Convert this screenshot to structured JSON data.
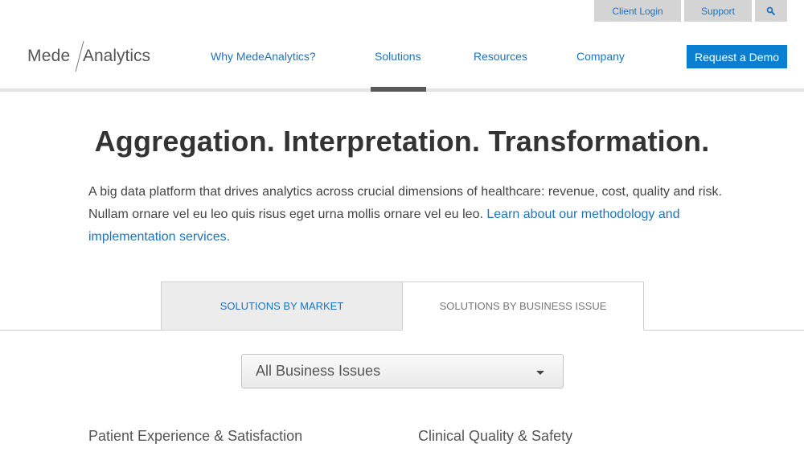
{
  "utility": {
    "client_login": "Client Login",
    "support": "Support",
    "search_icon": "search-icon"
  },
  "logo": {
    "part1": "Mede",
    "part2": "Analytics"
  },
  "nav": {
    "items": [
      {
        "label": "Why MedeAnalytics?"
      },
      {
        "label": "Solutions",
        "active": true
      },
      {
        "label": "Resources"
      },
      {
        "label": "Company"
      }
    ],
    "cta": "Request a Demo"
  },
  "hero": {
    "title": "Aggregation. Interpretation. Transformation.",
    "intro_text": "A big data platform that drives analytics across crucial dimensions of healthcare: revenue, cost, quality and risk. Nullam ornare vel eu leo quis risus eget urna mollis ornare vel eu leo.",
    "intro_link": "Learn about our methodology and implementation services."
  },
  "tabs": [
    {
      "label": "SOLUTIONS BY MARKET"
    },
    {
      "label": "SOLUTIONS BY BUSINESS ISSUE",
      "active": true
    }
  ],
  "filter": {
    "selected": "All Business Issues"
  },
  "categories": [
    {
      "label": "Patient Experience & Satisfaction"
    },
    {
      "label": "Clinical Quality & Safety"
    }
  ],
  "colors": {
    "link": "#1e73be",
    "cta_bg": "#0a7fd1",
    "utility_bg": "#d4d4d4"
  }
}
